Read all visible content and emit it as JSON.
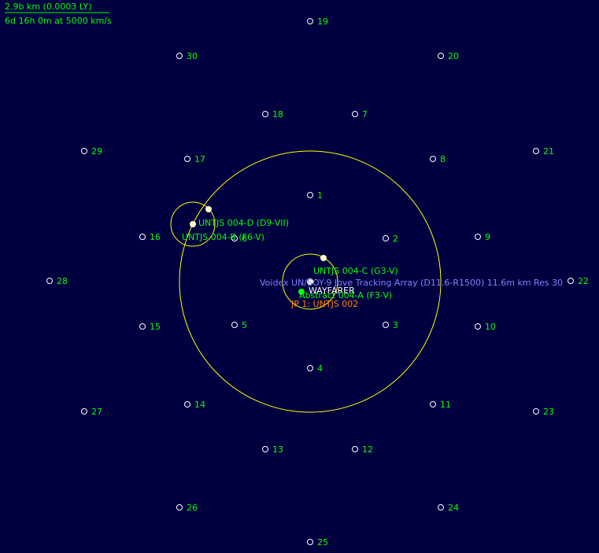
{
  "header": {
    "scale_distance": "2.9b km  (0.0003 LY)",
    "travel_time": "6d 16h 0m at 5000 km/s"
  },
  "colors": {
    "background": "#000040",
    "orbit": "#ffff00",
    "star_label": "#00ff00",
    "jump_point": "#ff8000",
    "selected_body": "#8080ff",
    "fleet": "#ffffff",
    "body_fill": "#ffffcc"
  },
  "waypoints": [
    {
      "id": "1",
      "label": "1"
    },
    {
      "id": "2",
      "label": "2"
    },
    {
      "id": "3",
      "label": "3"
    },
    {
      "id": "4",
      "label": "4"
    },
    {
      "id": "5",
      "label": "5"
    },
    {
      "id": "6",
      "label": "6"
    },
    {
      "id": "7",
      "label": "7"
    },
    {
      "id": "8",
      "label": "8"
    },
    {
      "id": "9",
      "label": "9"
    },
    {
      "id": "10",
      "label": "10"
    },
    {
      "id": "11",
      "label": "11"
    },
    {
      "id": "12",
      "label": "12"
    },
    {
      "id": "13",
      "label": "13"
    },
    {
      "id": "14",
      "label": "14"
    },
    {
      "id": "15",
      "label": "15"
    },
    {
      "id": "16",
      "label": "16"
    },
    {
      "id": "17",
      "label": "17"
    },
    {
      "id": "18",
      "label": "18"
    },
    {
      "id": "19",
      "label": "19"
    },
    {
      "id": "20",
      "label": "20"
    },
    {
      "id": "21",
      "label": "21"
    },
    {
      "id": "22",
      "label": "22"
    },
    {
      "id": "23",
      "label": "23"
    },
    {
      "id": "24",
      "label": "24"
    },
    {
      "id": "25",
      "label": "25"
    },
    {
      "id": "26",
      "label": "26"
    },
    {
      "id": "27",
      "label": "27"
    },
    {
      "id": "28",
      "label": "28"
    },
    {
      "id": "29",
      "label": "29"
    },
    {
      "id": "30",
      "label": "30"
    }
  ],
  "labels": {
    "star_d": "UNTJS 004-D (D9-VII)",
    "star_b": "UNTJS 004-B (F6-V)",
    "star_c": "UNTJS 004-C (G3-V)",
    "selected_body": "Voidex UN/SOY-9 Jove Tracking Array (D11.6-R1500) 11.6m km  Res 30",
    "fleet": "WAYFARER",
    "star_a": "Abstract 004-A (F3-V)",
    "jump_point": "JP 1: UNTJS 002"
  }
}
